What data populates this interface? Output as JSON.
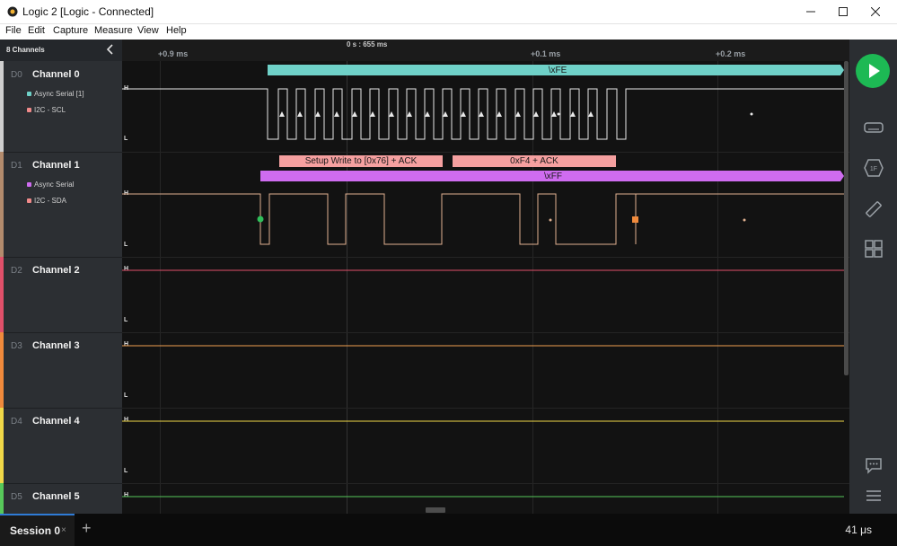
{
  "window": {
    "title": "Logic 2 [Logic - Connected]"
  },
  "menu": [
    "File",
    "Edit",
    "Capture",
    "Measure",
    "View",
    "Help"
  ],
  "panel": {
    "header": "8 Channels"
  },
  "channels": [
    {
      "id": "D0",
      "name": "Channel 0",
      "color": "#cfcfcf",
      "analyzers": [
        {
          "label": "Async Serial [1]",
          "color": "#6fd1c8"
        },
        {
          "label": "I2C - SCL",
          "color": "#f08a8a"
        }
      ]
    },
    {
      "id": "D1",
      "name": "Channel 1",
      "color": "#b38b6d",
      "analyzers": [
        {
          "label": "Async Serial",
          "color": "#cf6cf0"
        },
        {
          "label": "I2C - SDA",
          "color": "#f08a8a"
        }
      ]
    },
    {
      "id": "D2",
      "name": "Channel 2",
      "color": "#e0506a",
      "analyzers": []
    },
    {
      "id": "D3",
      "name": "Channel 3",
      "color": "#f08a3c",
      "analyzers": []
    },
    {
      "id": "D4",
      "name": "Channel 4",
      "color": "#f0d848",
      "analyzers": []
    },
    {
      "id": "D5",
      "name": "Channel 5",
      "color": "#57c85a",
      "analyzers": []
    }
  ],
  "timeline": {
    "cursor_label": "0 s : 655 ms",
    "ticks": [
      "+0.9 ms",
      "+0.1 ms",
      "+0.2 ms"
    ]
  },
  "levels": {
    "high": "H",
    "low": "L"
  },
  "annotations": {
    "ch0_serial": "\\xFE",
    "ch1_i2c_addr": "Setup Write to [0x76] + ACK",
    "ch1_i2c_data": "0xF4 + ACK",
    "ch1_serial": "\\xFF"
  },
  "session": {
    "name": "Session 0",
    "close": "×",
    "add": "+"
  },
  "zoom": "41 μs",
  "colors": {
    "accent": "#1db954",
    "serial_teal": "#6fd1c8",
    "serial_purple": "#cf6cf0",
    "i2c_pink": "#f5a0a0"
  },
  "icons": [
    "app-logo-icon",
    "minimize-icon",
    "maximize-icon",
    "close-icon",
    "chevron-left-icon",
    "play-icon",
    "device-icon",
    "analyzer-icon",
    "measure-icon",
    "extensions-icon",
    "feedback-icon",
    "menu-icon"
  ]
}
